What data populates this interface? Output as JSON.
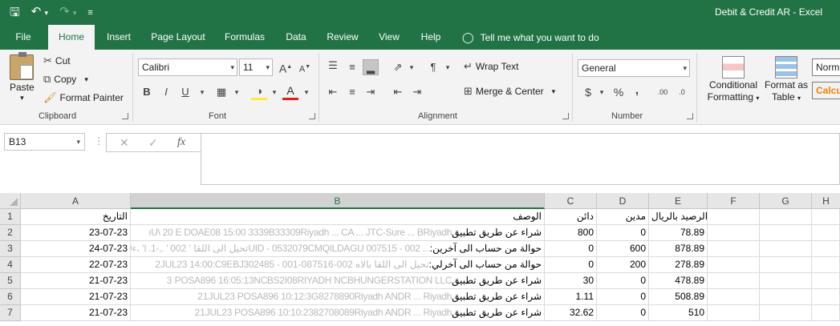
{
  "window": {
    "title": "Debit & Credit AR  -  Excel"
  },
  "qat": {
    "save_icon": "save-icon",
    "undo_icon": "undo-icon",
    "redo_icon": "redo-icon",
    "customize_icon": "customize-qat-icon"
  },
  "tabs": [
    {
      "label": "File"
    },
    {
      "label": "Home"
    },
    {
      "label": "Insert"
    },
    {
      "label": "Page Layout"
    },
    {
      "label": "Formulas"
    },
    {
      "label": "Data"
    },
    {
      "label": "Review"
    },
    {
      "label": "View"
    },
    {
      "label": "Help"
    },
    {
      "label": "Tell me what you want to do"
    }
  ],
  "ribbon": {
    "clipboard": {
      "label": "Clipboard",
      "paste": "Paste",
      "cut": "Cut",
      "copy": "Copy",
      "format_painter": "Format Painter"
    },
    "font": {
      "label": "Font",
      "name": "Calibri",
      "size": "11"
    },
    "alignment": {
      "label": "Alignment",
      "wrap_text": "Wrap Text",
      "merge_center": "Merge & Center"
    },
    "number": {
      "label": "Number",
      "format": "General"
    },
    "styles": {
      "conditional_formatting_1": "Conditional",
      "conditional_formatting_2": "Formatting",
      "format_as_table_1": "Format as",
      "format_as_table_2": "Table",
      "normal": "Norm",
      "calculation": "Calcu"
    }
  },
  "formula_bar": {
    "name_box": "B13",
    "fx": "fx",
    "value": ""
  },
  "grid": {
    "columns": [
      "A",
      "B",
      "C",
      "D",
      "E",
      "F",
      "G",
      "H"
    ],
    "rows": [
      {
        "num": "1",
        "a": "التاريخ",
        "b_fade": "",
        "b": "الوصف",
        "c": "دائن",
        "d": "مدين",
        "e": "الرصيد بالريال"
      },
      {
        "num": "2",
        "a": "23-07-23",
        "b_fade": "ıU\\ 20 E DOAE08 15:00 3339B33309Riyadh ... CA ... JTC-Sure ... BRiyadh",
        "b": "شراء عن طريق تطبيق",
        "c": "800",
        "d": "0",
        "e": "78.89"
      },
      {
        "num": "3",
        "a": "24-07-23",
        "b_fade": "9ء،  'l .1-,.   ' تحيل الى اللقا  ' 002UID - 0532079CMQILDAGU  007515 - 002 ...",
        "b": "حوالة من حساب الى آخرين:",
        "c": "0",
        "d": "600",
        "e": "878.89"
      },
      {
        "num": "4",
        "a": "22-07-23",
        "b_fade": "2JUL23 14:00:C9EBJ302485 - تحيل الى اللقا  بالاه 002-087516-001",
        "b": "حوالة من حساب الى آخرلي:",
        "c": "0",
        "d": "200",
        "e": "278.89"
      },
      {
        "num": "5",
        "a": "21-07-23",
        "b_fade": "3 POSA896 16:05:13NCBS2I08RIYADH          NCBHUNGERSTATION LLC",
        "b": "شراء عن طريق تطبيق",
        "c": "30",
        "d": "0",
        "e": "478.89"
      },
      {
        "num": "6",
        "a": "21-07-23",
        "b_fade": "21JUL23 POSA896 10:12:3G8278890Riyadh          ANDR ... Riyadh",
        "b": "شراء عن طريق تطبيق",
        "c": "1.11",
        "d": "0",
        "e": "508.89"
      },
      {
        "num": "7",
        "a": "21-07-23",
        "b_fade": "21JUL23 POSA896 10:10:2382708089Riyadh          ANDR ... Riyadh",
        "b": "شراء عن طريق تطبيق",
        "c": "32.62",
        "d": "0",
        "e": "510"
      }
    ]
  }
}
